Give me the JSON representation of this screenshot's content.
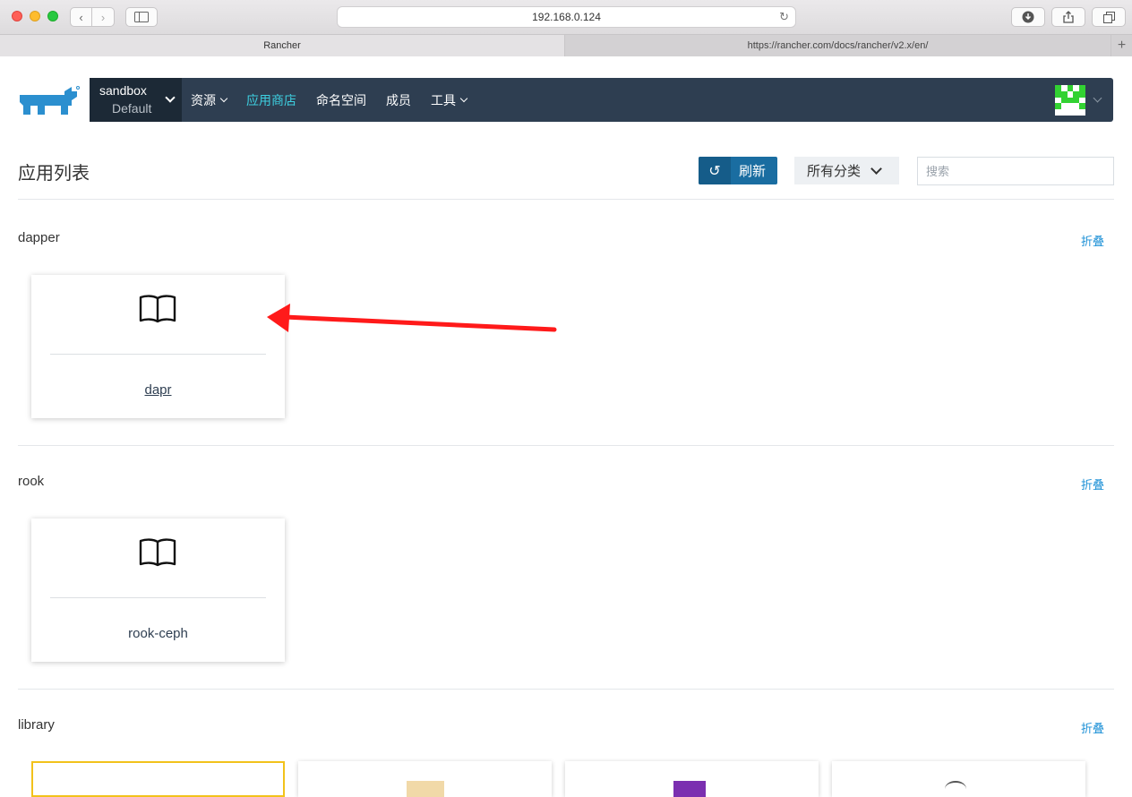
{
  "browser": {
    "url": "192.168.0.124",
    "tabs": [
      {
        "label": "Rancher"
      },
      {
        "label": "https://rancher.com/docs/rancher/v2.x/en/"
      }
    ]
  },
  "header": {
    "env_name": "sandbox",
    "env_sub": "Default",
    "nav": [
      {
        "label": "资源",
        "dropdown": true
      },
      {
        "label": "应用商店",
        "active": true
      },
      {
        "label": "命名空间"
      },
      {
        "label": "成员"
      },
      {
        "label": "工具",
        "dropdown": true
      }
    ],
    "accent_color": "#3dcfe0",
    "bg_color": "#2e3e51"
  },
  "toolbar": {
    "title": "应用列表",
    "refresh_label": "刷新",
    "category_label": "所有分类",
    "search_placeholder": "搜索"
  },
  "sections": [
    {
      "name": "dapper",
      "fold_label": "折叠",
      "apps": [
        {
          "name": "dapr",
          "icon": "book-icon"
        }
      ]
    },
    {
      "name": "rook",
      "fold_label": "折叠",
      "apps": [
        {
          "name": "rook-ceph",
          "icon": "book-icon"
        }
      ]
    },
    {
      "name": "library",
      "fold_label": "折叠",
      "apps": []
    }
  ]
}
